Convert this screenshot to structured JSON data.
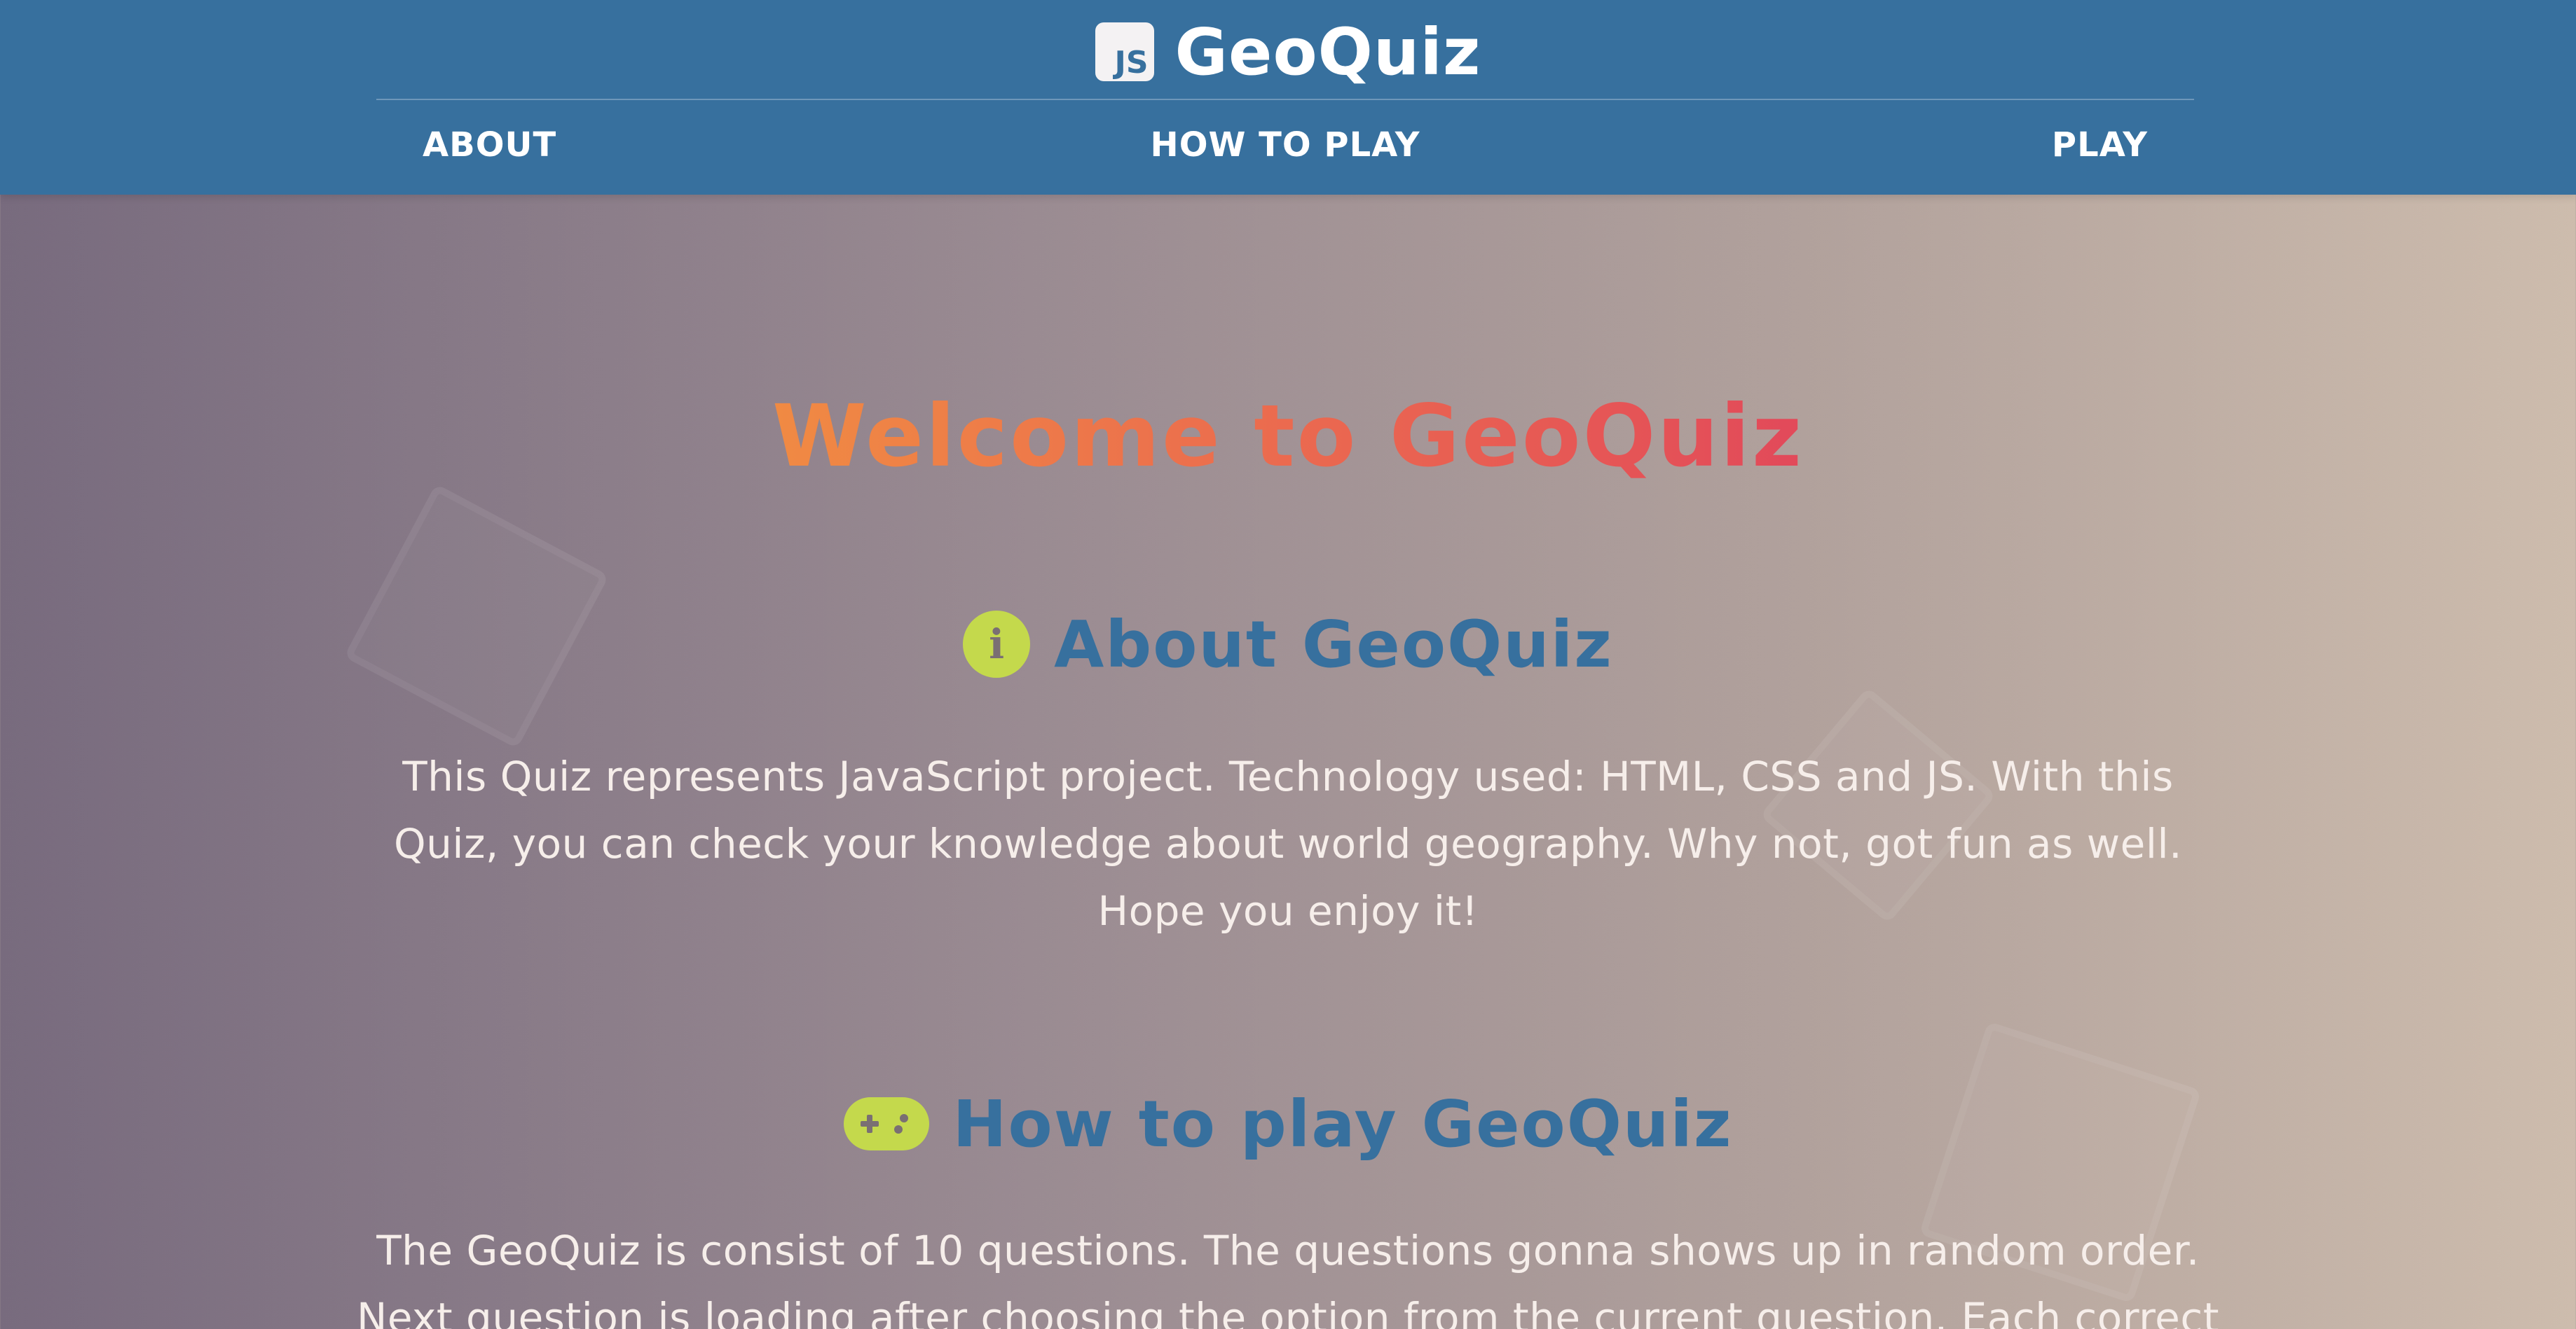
{
  "header": {
    "logo_text": "JS",
    "title": "GeoQuiz",
    "nav": {
      "about": "ABOUT",
      "how_to_play": "HOW TO PLAY",
      "play": "PLAY"
    }
  },
  "main": {
    "welcome": "Welcome to GeoQuiz",
    "about": {
      "icon": "info-icon",
      "title": "About GeoQuiz",
      "body": "This Quiz represents JavaScript project. Technology used: HTML, CSS and JS. With this Quiz, you can check your knowledge about world geography. Why not, got fun as well. Hope you enjoy it!"
    },
    "how_to_play": {
      "icon": "gamepad-icon",
      "title": "How to play GeoQuiz",
      "body": "The GeoQuiz is consist of 10 questions. The questions gonna shows up in random order. Next question is loading after choosing the option from the current question. Each correct"
    }
  },
  "colors": {
    "header_bg": "#37709e",
    "accent_green": "#c4d94c",
    "welcome_gradient_start": "#f08a43",
    "welcome_gradient_end": "#e2495a"
  }
}
